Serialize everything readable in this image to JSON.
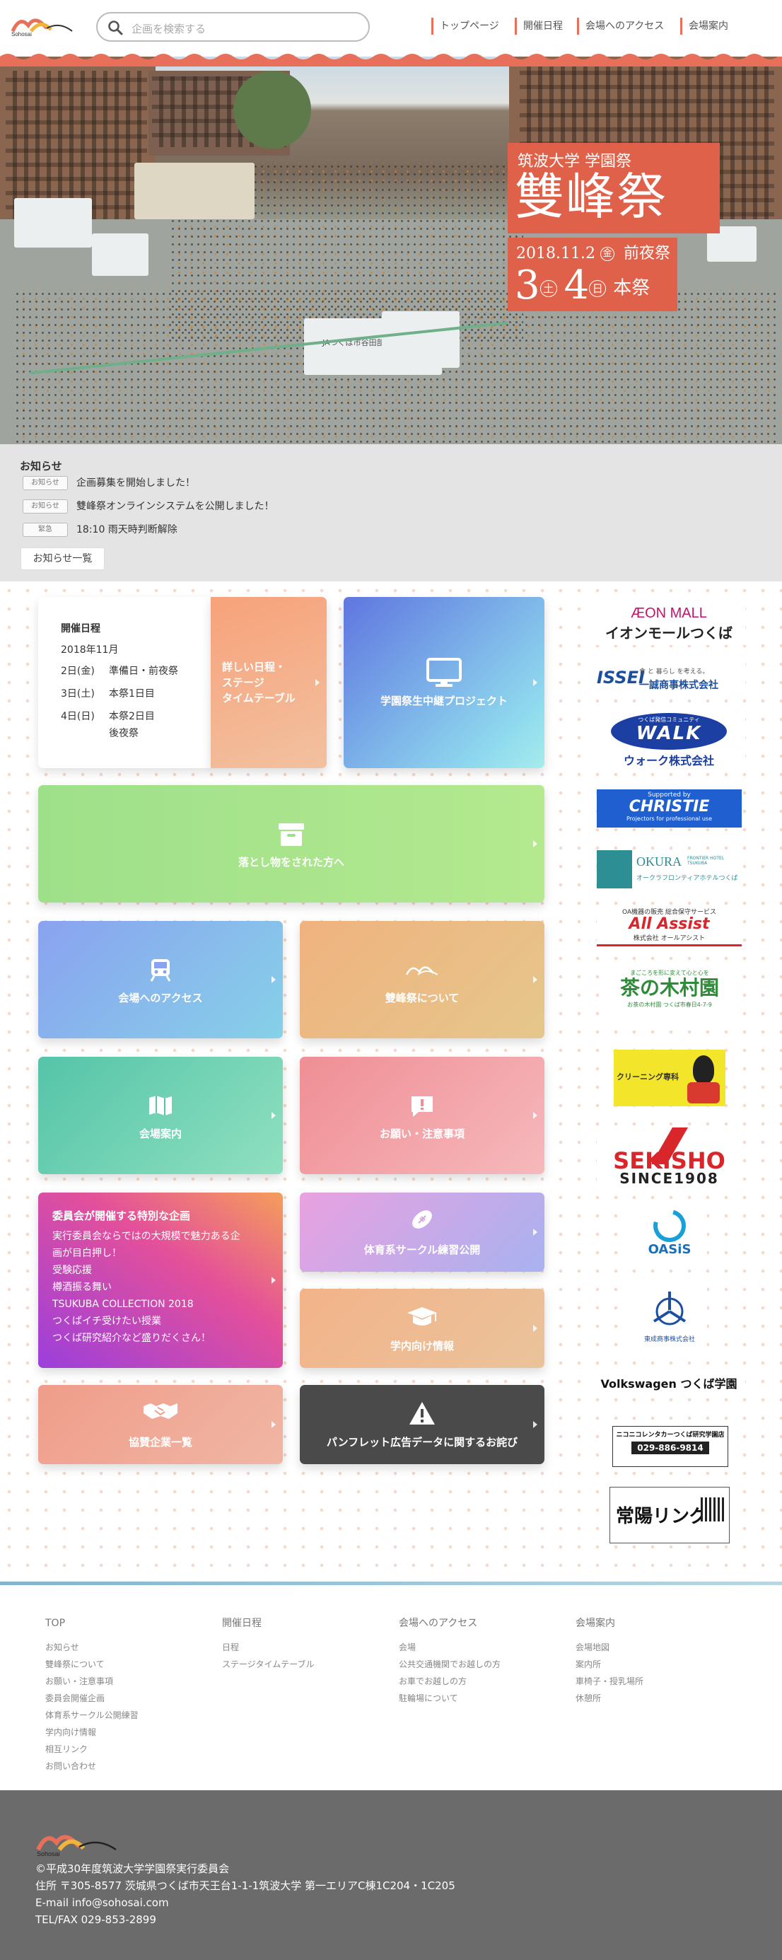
{
  "header": {
    "logo_text": "Sohosai",
    "search_placeholder": "企画を検索する",
    "nav": [
      "トップページ",
      "開催日程",
      "会場へのアクセス",
      "会場案内"
    ]
  },
  "hero": {
    "subtitle": "筑波大学 学園祭",
    "title": "雙峰祭",
    "date_line": "2018.11.2",
    "day1": "金",
    "eve_label": "前夜祭",
    "d3": "3",
    "day3": "土",
    "d4": "4",
    "day4": "日",
    "main_label": "本祭",
    "tent_sign": "JAつくば市谷田部"
  },
  "notices": {
    "title": "お知らせ",
    "items": [
      {
        "tag": "お知らせ",
        "text": "企画募集を開始しました！"
      },
      {
        "tag": "お知らせ",
        "text": "雙峰祭オンラインシステムを公開しました！"
      },
      {
        "tag": "緊急",
        "text": "18:10 雨天時判断解除"
      }
    ],
    "list_button": "お知らせ一覧"
  },
  "schedule": {
    "title": "開催日程",
    "month": "2018年11月",
    "rows": [
      {
        "day": "2日(金)",
        "desc": "準備日・前夜祭"
      },
      {
        "day": "3日(土)",
        "desc": "本祭1日目"
      },
      {
        "day": "4日(日)",
        "desc": "本祭2日目"
      }
    ],
    "extra": "後夜祭",
    "detail_lines": [
      "詳しい日程・",
      "ステージ",
      "タイムテーブル"
    ]
  },
  "cards": {
    "broadcast": "学園祭生中継プロジェクト",
    "lost": "落とし物をされた方へ",
    "access": "会場へのアクセス",
    "about": "雙峰祭について",
    "guide": "会場案内",
    "notes": "お願い・注意事項",
    "special_title": "委員会が開催する特別な企画",
    "special_lines": [
      "実行委員会ならではの大規模で魅力ある企",
      "画が目白押し！",
      "受験応援",
      "樽酒振る舞い",
      "TSUKUBA COLLECTION 2018",
      "つくばイチ受けたい授業",
      "つくば研究紹介など盛りだくさん！"
    ],
    "sports": "体育系サークル練習公開",
    "campus": "学内向け情報",
    "sponsors": "協賛企業一覧",
    "pamphlet": "パンフレット広告データに関するお詫び"
  },
  "sponsors": {
    "aeon_top": "ÆON MALL",
    "aeon_bottom": "イオンモールつくば",
    "issei_logo": "ISSEI",
    "issei_tag": "食 と 暮らし を考える。",
    "issei_name": "一誠商事株式会社",
    "walk_top": "つくば発信コミュニティ",
    "walk_logo": "WALK",
    "walk_name": "ウォーク株式会社",
    "christie_top": "Supported by",
    "christie_logo": "CHRISTIE",
    "christie_sub": "Projectors for professional use",
    "okura_logo": "OKURA",
    "okura_sub": "FRONTIER HOTEL TSUKUBA",
    "okura_jp": "オークラフロンティアホテルつくば",
    "allassist_top": "OA機器の販売 総合保守サービス",
    "allassist_logo": "All Assist",
    "allassist_name": "株式会社 オールアシスト",
    "tea_top": "まごころを形に変えて心と心を",
    "tea_logo": "茶の木村園",
    "tea_sub": "お茶の木村園 つくば市春日4-7-9",
    "cleaning": "クリーニング専科",
    "sekisho": "SEKISHO",
    "sekisho_since": "SINCE1908",
    "oasis": "OASiS",
    "toei": "東成商事株式会社",
    "vw": "Volkswagen つくば学園",
    "niko_name": "ニコニコレンタカーつくば研究学園店",
    "niko_tel": "029-886-9814",
    "tsuneyo": "常陽リング"
  },
  "footnav": {
    "cols": [
      {
        "head": "TOP",
        "items": [
          "お知らせ",
          "雙峰祭について",
          "お願い・注意事項",
          "委員会開催企画",
          "体育系サークル公開練習",
          "学内向け情報",
          "相互リンク",
          "お問い合わせ"
        ]
      },
      {
        "head": "開催日程",
        "items": [
          "日程",
          "ステージタイムテーブル"
        ]
      },
      {
        "head": "会場へのアクセス",
        "items": [
          "会場",
          "公共交通機関でお越しの方",
          "お車でお越しの方",
          "駐輪場について"
        ]
      },
      {
        "head": "会場案内",
        "items": [
          "会場地図",
          "案内所",
          "車椅子・授乳場所",
          "休憩所"
        ]
      }
    ]
  },
  "footer": {
    "copyright": "©平成30年度筑波大学学園祭実行委員会",
    "address": "住所 〒305-8577 茨城県つくば市天王台1-1-1筑波大学 第一エリアC棟1C204・1C205",
    "email": "E-mail info@sohosai.com",
    "tel": "TEL/FAX 029-853-2899"
  },
  "colors": {
    "accent": "#e8705a",
    "footer_bg": "#6b6b6b",
    "notice_bg": "#e4e4e4"
  }
}
